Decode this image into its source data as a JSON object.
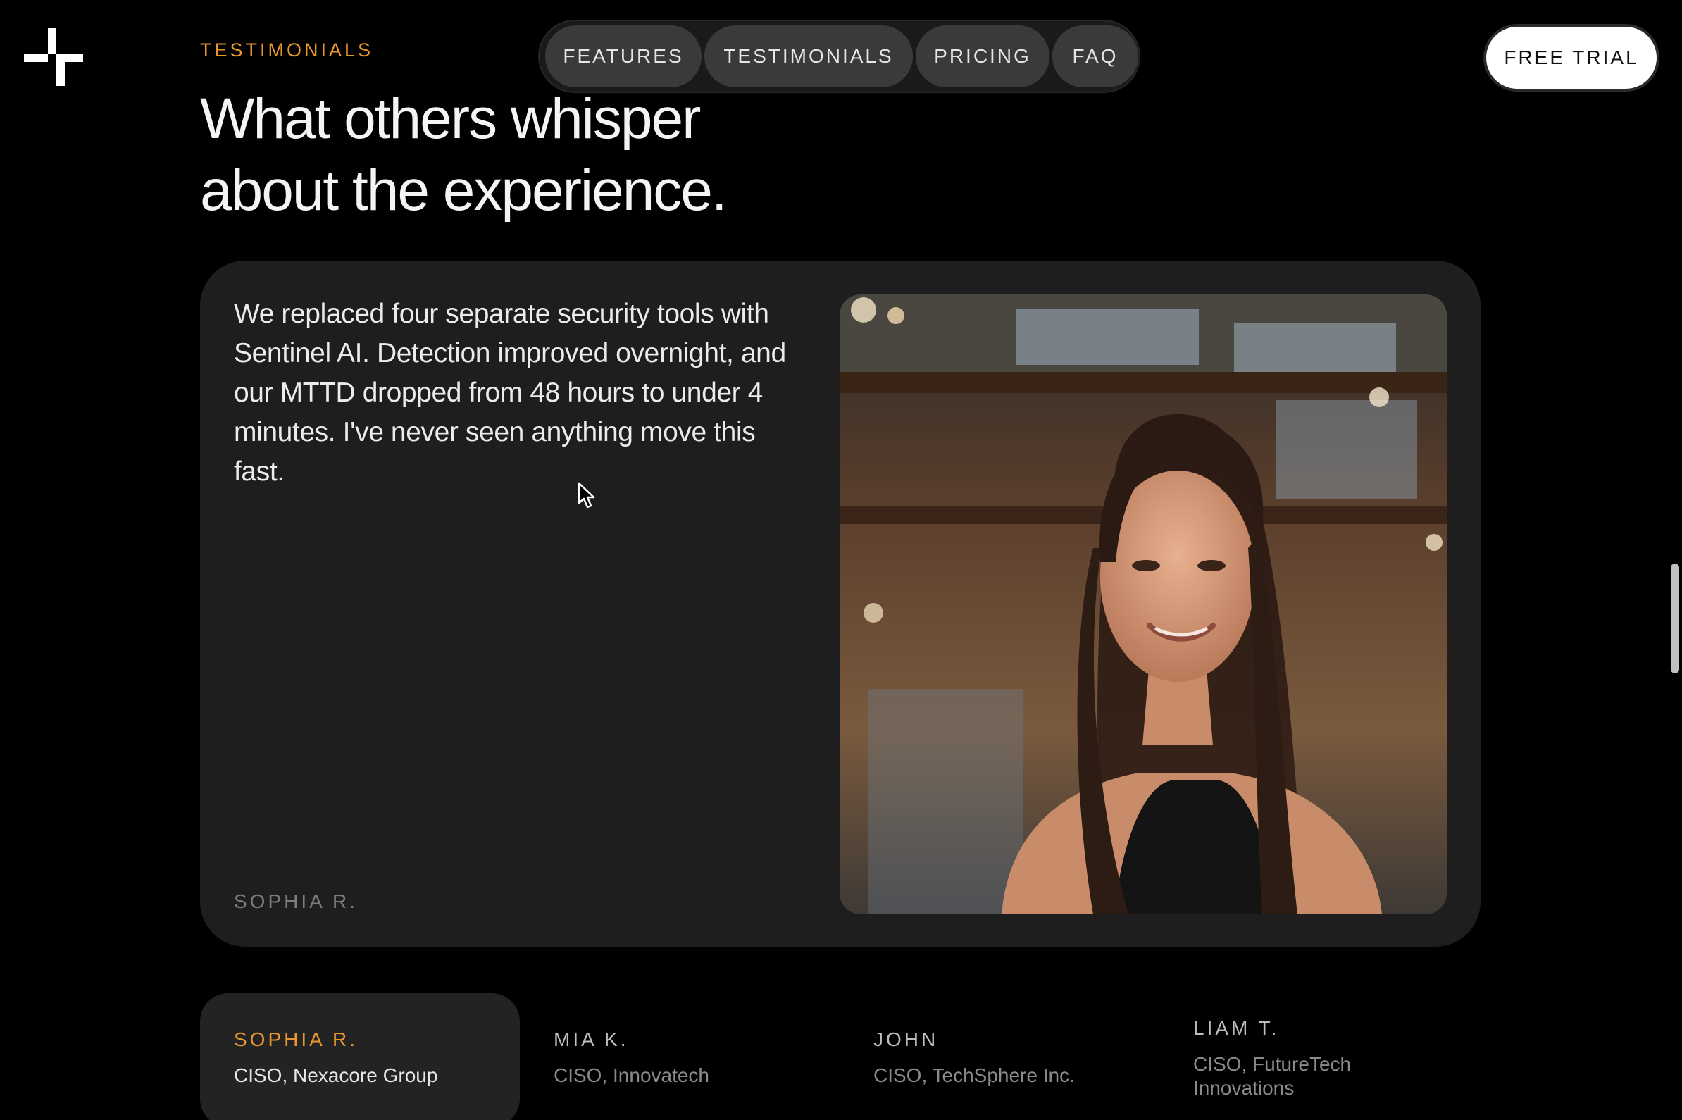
{
  "brand": {
    "accent": "#e8962e",
    "logo_icon": "cross-split-logo-icon"
  },
  "section": {
    "eyebrow": "TESTIMONIALS",
    "heading_line1": "What others whisper",
    "heading_line2": "about the experience."
  },
  "nav": {
    "items": [
      {
        "label": "FEATURES"
      },
      {
        "label": "TESTIMONIALS"
      },
      {
        "label": "PRICING"
      },
      {
        "label": "FAQ"
      }
    ],
    "cta_label": "FREE TRIAL"
  },
  "testimonial": {
    "quote": "We replaced four separate security tools with Sentinel AI. Detection improved overnight, and our MTTD dropped from 48 hours to under 4 minutes. I've never seen anything move this fast.",
    "author": "SOPHIA R."
  },
  "people": [
    {
      "name": "SOPHIA R.",
      "role": "CISO, Nexacore Group",
      "active": true
    },
    {
      "name": "MIA K.",
      "role": "CISO, Innovatech",
      "active": false
    },
    {
      "name": "JOHN",
      "role": "CISO, TechSphere Inc.",
      "active": false
    },
    {
      "name": "LIAM T.",
      "role": "CISO, FutureTech Innovations",
      "active": false
    }
  ]
}
